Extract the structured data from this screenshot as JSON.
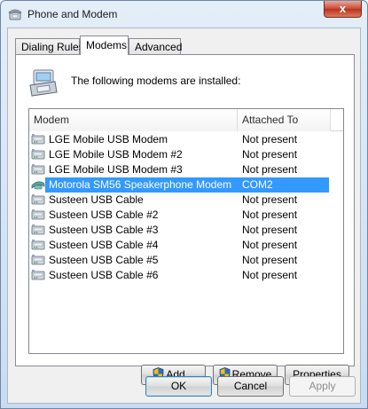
{
  "window": {
    "title": "Phone and Modem",
    "close_label": "x"
  },
  "tabs": [
    {
      "label": "Dialing Rules",
      "active": false
    },
    {
      "label": "Modems",
      "active": true
    },
    {
      "label": "Advanced",
      "active": false
    }
  ],
  "panel": {
    "intro": "The following modems are installed:"
  },
  "list": {
    "columns": {
      "modem": "Modem",
      "attached": "Attached To"
    },
    "rows": [
      {
        "name": "LGE Mobile USB Modem",
        "attached": "Not present",
        "icon": "modem-icon",
        "selected": false
      },
      {
        "name": "LGE Mobile USB Modem #2",
        "attached": "Not present",
        "icon": "modem-icon",
        "selected": false
      },
      {
        "name": "LGE Mobile USB Modem #3",
        "attached": "Not present",
        "icon": "modem-icon",
        "selected": false
      },
      {
        "name": "Motorola SM56 Speakerphone Modem",
        "attached": "COM2",
        "icon": "speakerphone-modem-icon",
        "selected": true
      },
      {
        "name": "Susteen USB Cable",
        "attached": "Not present",
        "icon": "modem-icon",
        "selected": false
      },
      {
        "name": "Susteen USB Cable #2",
        "attached": "Not present",
        "icon": "modem-icon",
        "selected": false
      },
      {
        "name": "Susteen USB Cable #3",
        "attached": "Not present",
        "icon": "modem-icon",
        "selected": false
      },
      {
        "name": "Susteen USB Cable #4",
        "attached": "Not present",
        "icon": "modem-icon",
        "selected": false
      },
      {
        "name": "Susteen USB Cable #5",
        "attached": "Not present",
        "icon": "modem-icon",
        "selected": false
      },
      {
        "name": "Susteen USB Cable #6",
        "attached": "Not present",
        "icon": "modem-icon",
        "selected": false
      }
    ]
  },
  "buttons": {
    "add": "Add...",
    "remove": "Remove",
    "properties": "Properties",
    "ok": "OK",
    "cancel": "Cancel",
    "apply": "Apply"
  },
  "colors": {
    "selection": "#3399ff",
    "shield_blue": "#2b6cc4",
    "shield_yellow": "#f2c200"
  }
}
